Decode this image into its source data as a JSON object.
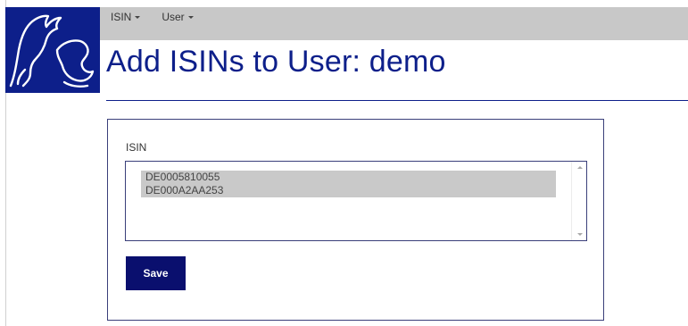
{
  "colors": {
    "brand": "#0d1f8a",
    "navbar_bg": "#c8c8c8",
    "button_bg": "#0a0f6e",
    "selected_option_bg": "#c9c9c9"
  },
  "logo": {
    "icon": "bull-bear-logo"
  },
  "nav": {
    "items": [
      {
        "label": "ISIN"
      },
      {
        "label": "User"
      }
    ]
  },
  "page": {
    "title": "Add ISINs to User: demo"
  },
  "form": {
    "isin_label": "ISIN",
    "isin_options": [
      {
        "value": "DE0005810055",
        "selected": true
      },
      {
        "value": "DE000A2AA253",
        "selected": true
      }
    ],
    "save_label": "Save"
  }
}
